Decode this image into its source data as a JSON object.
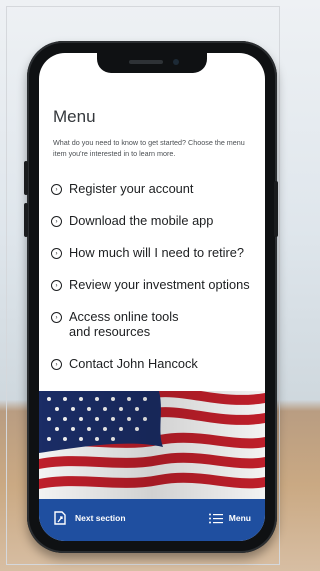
{
  "menu": {
    "title": "Menu",
    "subtitle": "What do you need to know to get started? Choose the menu item you're interested in to learn more.",
    "items": [
      {
        "label": "Register your account",
        "icon": "chevron-circle-right-icon"
      },
      {
        "label": "Download the mobile app",
        "icon": "chevron-circle-right-icon"
      },
      {
        "label": "How much will I need to retire?",
        "icon": "chevron-circle-right-icon"
      },
      {
        "label": "Review your investment options",
        "icon": "chevron-circle-right-icon"
      },
      {
        "label": "Access online tools\nand resources",
        "icon": "chevron-circle-right-icon"
      },
      {
        "label": "Contact John Hancock",
        "icon": "chevron-circle-right-icon"
      }
    ]
  },
  "bottom_bar": {
    "next_label": "Next section",
    "menu_label": "Menu",
    "color": "#1f4fa0"
  },
  "colors": {
    "accent_blue": "#1f4fa0",
    "flag_red": "#c8202c",
    "flag_blue": "#1c2f6b"
  }
}
